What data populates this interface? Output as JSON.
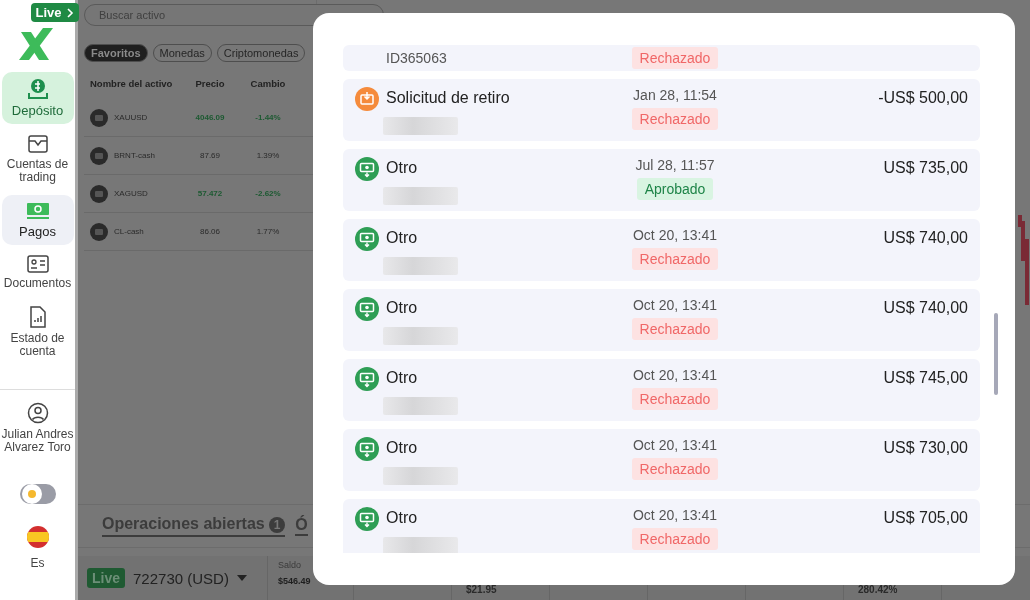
{
  "sidebar": {
    "badge": "Live",
    "items": [
      {
        "label": "Depósito",
        "kind": "cta",
        "selected": false
      },
      {
        "label": "Cuentas de trading",
        "kind": "nav",
        "selected": false
      },
      {
        "label": "Pagos",
        "kind": "nav",
        "selected": true
      },
      {
        "label": "Documentos",
        "kind": "nav",
        "selected": false
      },
      {
        "label": "Estado de cuenta",
        "kind": "nav",
        "selected": false
      }
    ],
    "user": "Julian Andres Alvarez Toro",
    "dark_mode": false,
    "language": "Es"
  },
  "market": {
    "search": {
      "placeholder": "Buscar activo"
    },
    "filters": [
      {
        "label": "Favoritos",
        "selected": true
      },
      {
        "label": "Monedas",
        "selected": false
      },
      {
        "label": "Criptomonedas",
        "selected": false
      }
    ],
    "columns": [
      "Nombre del activo",
      "Precio",
      "Cambio"
    ],
    "rows": [
      {
        "name": "XAUUSD",
        "price": "4046.09",
        "change": "-1.44%",
        "highlight": true
      },
      {
        "name": "BRNT-cash",
        "price": "87.69",
        "change": "1.39%",
        "highlight": false
      },
      {
        "name": "XAGUSD",
        "price": "57.472",
        "change": "-2.62%",
        "highlight": true
      },
      {
        "name": "CL-cash",
        "price": "86.06",
        "change": "1.77%",
        "highlight": false
      }
    ]
  },
  "positions_tab": {
    "label": "Operaciones abiertas",
    "count": "1",
    "next": "Ó"
  },
  "account_bar": {
    "badge": "Live",
    "account": "722730 (USD)",
    "balance_label": "Saldo",
    "balance": "$546.49",
    "stats": [
      "$21.95",
      "280.42%"
    ]
  },
  "transactions": [
    {
      "reference": "ID365063",
      "status": "Rechazado",
      "approved": false
    },
    {
      "kind": "withdrawal",
      "title": "Solicitud de retiro",
      "date": "Jan 28, 11:54",
      "status": "Rechazado",
      "approved": false,
      "amount": "-US$ 500,00"
    },
    {
      "kind": "other",
      "title": "Otro",
      "date": "Jul 28, 11:57",
      "status": "Aprobado",
      "approved": true,
      "amount": "US$ 735,00"
    },
    {
      "kind": "other",
      "title": "Otro",
      "date": "Oct 20, 13:41",
      "status": "Rechazado",
      "approved": false,
      "amount": "US$ 740,00"
    },
    {
      "kind": "other",
      "title": "Otro",
      "date": "Oct 20, 13:41",
      "status": "Rechazado",
      "approved": false,
      "amount": "US$ 740,00"
    },
    {
      "kind": "other",
      "title": "Otro",
      "date": "Oct 20, 13:41",
      "status": "Rechazado",
      "approved": false,
      "amount": "US$ 745,00"
    },
    {
      "kind": "other",
      "title": "Otro",
      "date": "Oct 20, 13:41",
      "status": "Rechazado",
      "approved": false,
      "amount": "US$ 730,00"
    },
    {
      "kind": "other",
      "title": "Otro",
      "date": "Oct 20, 13:41",
      "status": "Rechazado",
      "approved": false,
      "amount": "US$ 705,00"
    }
  ]
}
